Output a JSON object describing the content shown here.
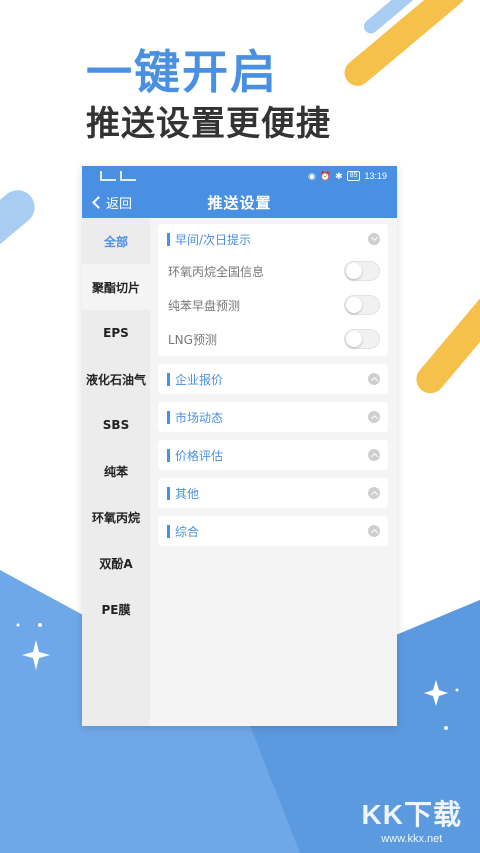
{
  "headline": "一键开启",
  "subhead": "推送设置更便捷",
  "statusbar": {
    "battery": "85",
    "time": "13:19"
  },
  "navbar": {
    "back_label": "返回",
    "title": "推送设置"
  },
  "sidebar": {
    "items": [
      {
        "label": "全部"
      },
      {
        "label": "聚酯切片"
      },
      {
        "label": "EPS"
      },
      {
        "label": "液化石油气"
      },
      {
        "label": "SBS"
      },
      {
        "label": "纯苯"
      },
      {
        "label": "环氧丙烷"
      },
      {
        "label": "双酚A"
      },
      {
        "label": "PE膜"
      }
    ]
  },
  "sections": [
    {
      "title": "早间/次日提示",
      "expanded": true,
      "toggles": [
        {
          "label": "环氧丙烷全国信息",
          "on": false
        },
        {
          "label": "纯苯早盘预测",
          "on": false
        },
        {
          "label": "LNG预测",
          "on": false
        }
      ]
    },
    {
      "title": "企业报价",
      "expanded": false
    },
    {
      "title": "市场动态",
      "expanded": false
    },
    {
      "title": "价格评估",
      "expanded": false
    },
    {
      "title": "其他",
      "expanded": false
    },
    {
      "title": "综合",
      "expanded": false
    }
  ],
  "watermark": {
    "brand": "KK下载",
    "url": "www.kkx.net"
  },
  "colors": {
    "accent": "#4A90E2",
    "decor_yellow": "#F5C14B",
    "decor_blue": "#6FA8E8"
  }
}
